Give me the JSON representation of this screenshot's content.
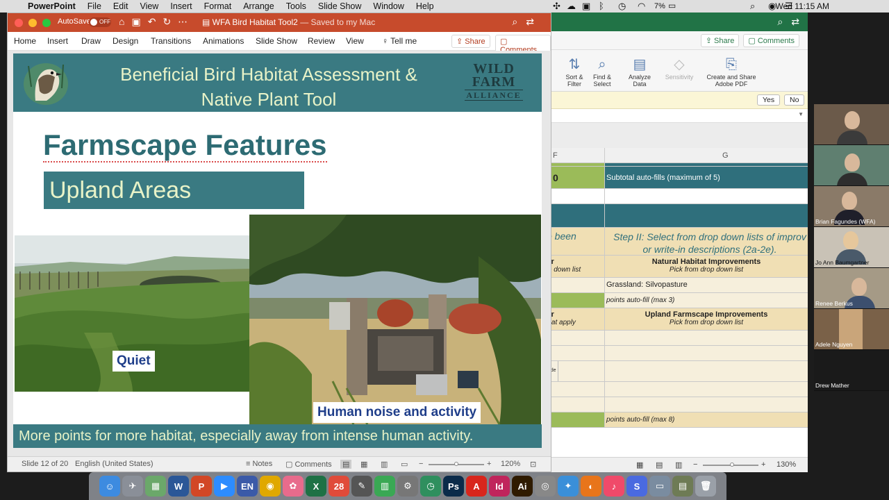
{
  "menubar": {
    "app": "PowerPoint",
    "items": [
      "File",
      "Edit",
      "View",
      "Insert",
      "Format",
      "Arrange",
      "Tools",
      "Slide Show",
      "Window",
      "Help"
    ],
    "battery": "7%",
    "clock": "Wed 11:15 AM"
  },
  "excel": {
    "tabs": {
      "share": "Share",
      "comments": "Comments"
    },
    "ribbon": [
      {
        "label": "Sort &\nFilter",
        "icon": "sort-filter-icon"
      },
      {
        "label": "Find &\nSelect",
        "icon": "find-select-icon"
      },
      {
        "label": "Analyze\nData",
        "icon": "analyze-data-icon"
      },
      {
        "label": "Sensitivity",
        "icon": "sensitivity-icon"
      },
      {
        "label": "Create and Share\nAdobe PDF",
        "icon": "adobe-pdf-icon"
      }
    ],
    "message_bar": {
      "yes": "Yes",
      "no": "No"
    },
    "columns": {
      "f": "F",
      "g": "G"
    },
    "rows": {
      "subtotal_value": "0",
      "subtotal_text": "Subtotal auto-fills (maximum of 5)",
      "step_left": "ve been",
      "step_text": "Step II: Select from drop down lists of improv or write-in descriptions (2a-2e).",
      "after_1": "fter",
      "after_1_sub": "rop down list",
      "nh_title": "Natural Habitat Improvements",
      "nh_sub": "Pick from drop down list",
      "grassland": "Grassland: Silvopasture",
      "points_3": "points auto-fill (max 3)",
      "after_2": "fter",
      "after_2_sub": "/ that apply",
      "uf_title": "Upland Farmscape Improvements",
      "uf_sub": "Pick from drop down list",
      "made": "made",
      "points_8": "points auto-fill (max 8)"
    },
    "status": {
      "zoom": "130%"
    }
  },
  "ppt": {
    "autosave_label": "AutoSave",
    "autosave_state": "OFF",
    "doc_title": "WFA Bird Habitat Tool2",
    "doc_saved": "— Saved to my Mac",
    "tabs": [
      "Home",
      "Insert",
      "Draw",
      "Design",
      "Transitions",
      "Animations",
      "Slide Show",
      "Review",
      "View"
    ],
    "tell_me": "Tell me",
    "share": "Share",
    "comments": "Comments",
    "slide": {
      "banner_title": "Beneficial Bird Habitat Assessment & Native Plant Tool",
      "logo_line1": "WILD",
      "logo_line2": "FARM",
      "logo_line3": "ALLIANCE",
      "title": "Farmscape Features",
      "subtitle": "Upland Areas",
      "label_quiet": "Quiet",
      "label_noise": "Human noise and activity",
      "footer": "More points for more habitat, especially away from intense human activity."
    },
    "status": {
      "slide": "Slide 12 of 20",
      "language": "English (United States)",
      "notes": "Notes",
      "comments": "Comments",
      "zoom": "120%"
    }
  },
  "zoom_participants": [
    {
      "name": "",
      "bg": "#6b5a4a",
      "shirt": "#3b3b3b"
    },
    {
      "name": "",
      "bg": "#5f7f70",
      "shirt": "#2e2e2e"
    },
    {
      "name": "Brian Fagundes (WFA)",
      "bg": "#8a7a68",
      "shirt": "#1f1f2a"
    },
    {
      "name": "Jo Ann Baumgartner",
      "bg": "#c9c2b6",
      "shirt": "#4a5a6a"
    },
    {
      "name": "Renee Berkus",
      "bg": "#a59a86",
      "shirt": "#3c4f6e"
    },
    {
      "name": "Adele Nguyen",
      "bg": "#7a6148",
      "shirt": ""
    },
    {
      "name": "Drew Mather",
      "bg": "#1a1a1a",
      "shirt": ""
    }
  ],
  "dock": [
    {
      "icon": "finder-icon",
      "glyph": "☺",
      "color": "#3d8be0"
    },
    {
      "icon": "launchpad-icon",
      "glyph": "✈",
      "color": "#8a8f98"
    },
    {
      "icon": "preview-icon",
      "glyph": "▦",
      "color": "#6ba86a"
    },
    {
      "icon": "word-icon",
      "glyph": "W",
      "color": "#2b5797"
    },
    {
      "icon": "powerpoint-icon",
      "glyph": "P",
      "color": "#d24726"
    },
    {
      "icon": "zoom-icon",
      "glyph": "▶",
      "color": "#2d8cff"
    },
    {
      "icon": "en-input-icon",
      "glyph": "EN",
      "color": "#3b5aa8"
    },
    {
      "icon": "chrome-icon",
      "glyph": "◉",
      "color": "#e0a800"
    },
    {
      "icon": "photos-icon",
      "glyph": "✿",
      "color": "#e86b8c"
    },
    {
      "icon": "excel-icon",
      "glyph": "X",
      "color": "#1e7145"
    },
    {
      "icon": "calendar-icon",
      "glyph": "28",
      "color": "#e04b3a"
    },
    {
      "icon": "stamp-icon",
      "glyph": "✎",
      "color": "#555"
    },
    {
      "icon": "numbers-icon",
      "glyph": "▥",
      "color": "#3aa854"
    },
    {
      "icon": "settings-icon",
      "glyph": "⚙",
      "color": "#777"
    },
    {
      "icon": "time-machine-icon",
      "glyph": "◷",
      "color": "#2f8f5e"
    },
    {
      "icon": "photoshop-icon",
      "glyph": "Ps",
      "color": "#0b2b4a"
    },
    {
      "icon": "acrobat-icon",
      "glyph": "A",
      "color": "#d8261c"
    },
    {
      "icon": "indesign-icon",
      "glyph": "Id",
      "color": "#c0255c"
    },
    {
      "icon": "illustrator-icon",
      "glyph": "Ai",
      "color": "#2f1b00"
    },
    {
      "icon": "disk-utility-icon",
      "glyph": "◎",
      "color": "#888"
    },
    {
      "icon": "safari-icon",
      "glyph": "✦",
      "color": "#3a8fd9"
    },
    {
      "icon": "firefox-icon",
      "glyph": "◐",
      "color": "#e8751a"
    },
    {
      "icon": "music-icon",
      "glyph": "♪",
      "color": "#f04a6a"
    },
    {
      "icon": "shortcuts-icon",
      "glyph": "S",
      "color": "#4a6ae0"
    },
    {
      "icon": "image-capture-icon",
      "glyph": "▭",
      "color": "#7a8ca0"
    },
    {
      "icon": "document-icon",
      "glyph": "▤",
      "color": "#6e7b55"
    },
    {
      "icon": "trash-icon",
      "glyph": "🗑",
      "color": "#9aa0a8"
    }
  ]
}
